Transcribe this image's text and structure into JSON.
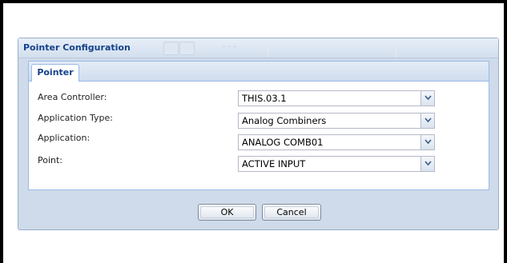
{
  "dialog": {
    "title": "Pointer Configuration",
    "header_ghost_text": "- - -"
  },
  "tabs": [
    {
      "label": "Pointer",
      "selected": true
    }
  ],
  "fields": [
    {
      "label": "Area Controller:",
      "value": "THIS.03.1"
    },
    {
      "label": "Application Type:",
      "value": "Analog Combiners"
    },
    {
      "label": "Application:",
      "value": "ANALOG COMB01"
    },
    {
      "label": "Point:",
      "value": "ACTIVE INPUT"
    }
  ],
  "buttons": {
    "ok_label": "OK",
    "cancel_label": "Cancel"
  },
  "icons": {
    "combo_trigger": "chevron-down-icon"
  },
  "colors": {
    "title_text": "#15428b",
    "panel_border": "#99bbe8",
    "dialog_background": "#cfdbea"
  }
}
